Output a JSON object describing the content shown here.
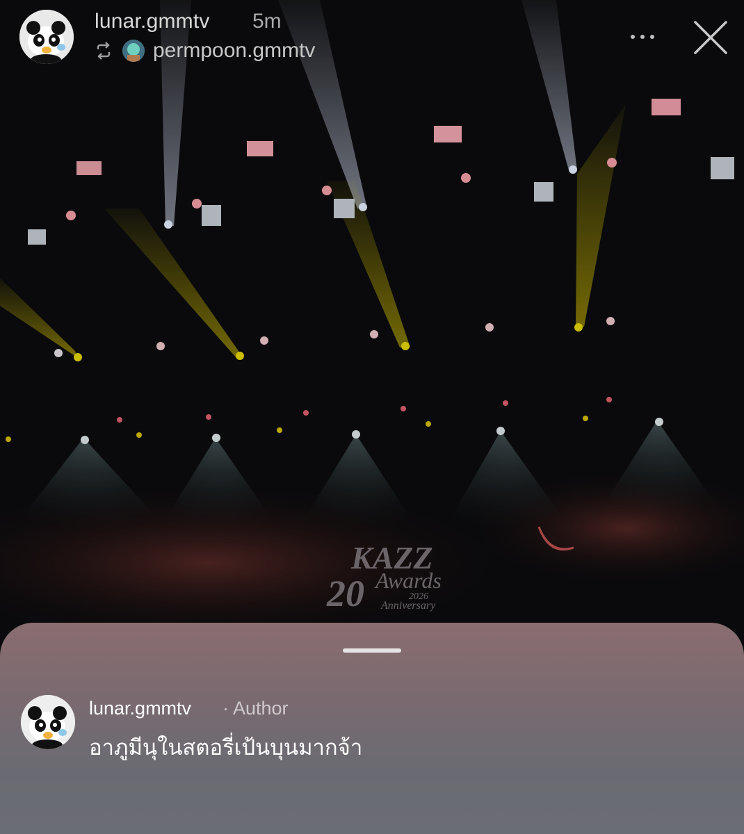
{
  "story": {
    "username": "lunar.gmmtv",
    "time_ago": "5m",
    "reposted_from": "permpoon.gmmtv",
    "logo_text": "KAZZ Awards 2026 20 Anniversary"
  },
  "icons": {
    "repost": "repost-icon",
    "more": "more-options-icon",
    "close": "close-icon"
  },
  "comment": {
    "username": "lunar.gmmtv",
    "author_badge": "· Author",
    "text": "อาภูมีนุในสตอรี่เป้นบุนมากจ้า"
  },
  "colors": {
    "background": "#0b0b0d",
    "sheet_top": "#8a6d70",
    "sheet_bottom": "#6b6d74"
  }
}
